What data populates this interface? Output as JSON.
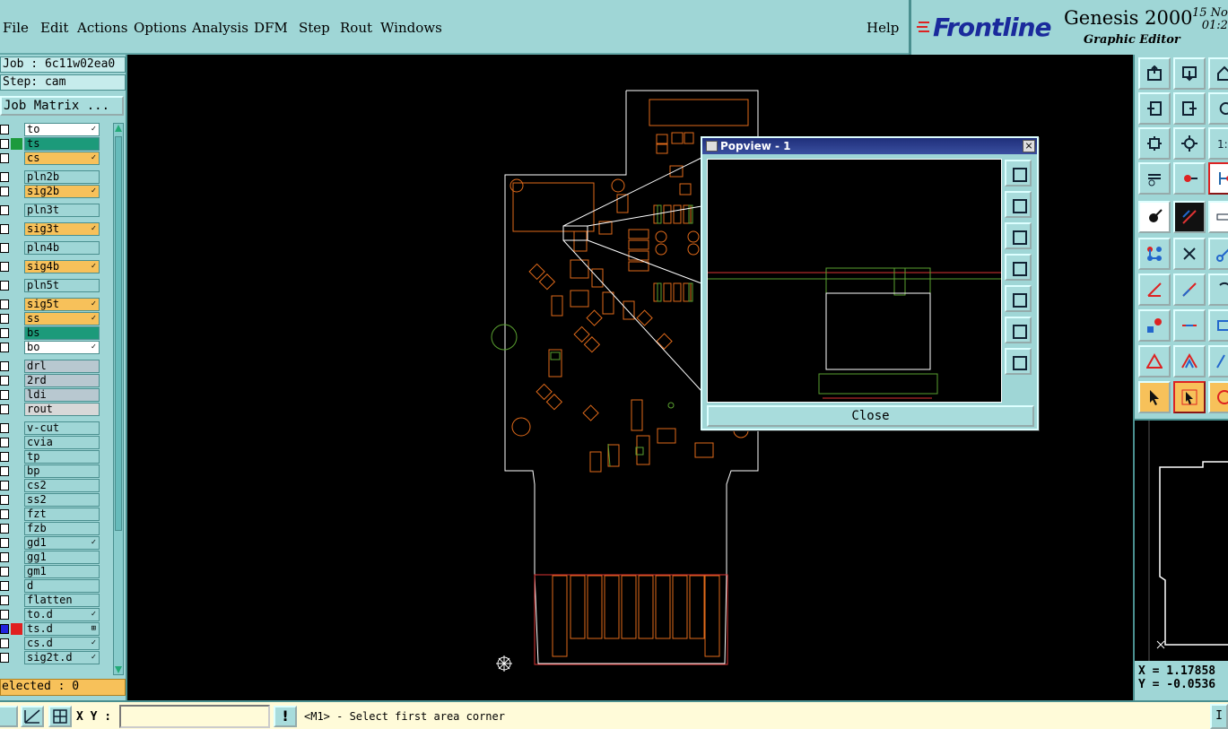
{
  "menu": {
    "items": [
      "File",
      "Edit",
      "Actions",
      "Options",
      "Analysis",
      "DFM",
      "Step",
      "Rout",
      "Windows"
    ],
    "help": "Help"
  },
  "brand": {
    "logo": "Frontline",
    "app": "Genesis 2000",
    "subtitle": "Graphic Editor",
    "date_line1": "15 No",
    "date_line2": "01:2"
  },
  "left": {
    "job": "Job : 6c11w02ea0",
    "step": "Step: cam",
    "job_matrix": "Job Matrix ...",
    "selected": "elected : 0",
    "layers": [
      {
        "name": "to",
        "bg": "#ffffff",
        "swatch": "",
        "mark": "✓"
      },
      {
        "name": "ts",
        "bg": "#1c9a7a",
        "swatch": "#1c9a3c",
        "mark": ""
      },
      {
        "name": "cs",
        "bg": "#f7c15a",
        "swatch": "",
        "mark": "✓"
      },
      {
        "name": "pln2b",
        "bg": "#9fd6d6",
        "swatch": "",
        "mark": ""
      },
      {
        "name": "sig2b",
        "bg": "#f7c15a",
        "swatch": "",
        "mark": "✓"
      },
      {
        "name": "pln3t",
        "bg": "#9fd6d6",
        "swatch": "",
        "mark": ""
      },
      {
        "name": "sig3t",
        "bg": "#f7c15a",
        "swatch": "",
        "mark": "✓"
      },
      {
        "name": "pln4b",
        "bg": "#9fd6d6",
        "swatch": "",
        "mark": ""
      },
      {
        "name": "sig4b",
        "bg": "#f7c15a",
        "swatch": "",
        "mark": "✓"
      },
      {
        "name": "pln5t",
        "bg": "#9fd6d6",
        "swatch": "",
        "mark": ""
      },
      {
        "name": "sig5t",
        "bg": "#f7c15a",
        "swatch": "",
        "mark": "✓"
      },
      {
        "name": "ss",
        "bg": "#f7c15a",
        "swatch": "",
        "mark": "✓"
      },
      {
        "name": "bs",
        "bg": "#1c9a7a",
        "swatch": "",
        "mark": ""
      },
      {
        "name": "bo",
        "bg": "#ffffff",
        "swatch": "",
        "mark": "✓"
      },
      {
        "name": "drl",
        "bg": "#b8c8d0",
        "swatch": "",
        "mark": ""
      },
      {
        "name": "2rd",
        "bg": "#b8c8d0",
        "swatch": "",
        "mark": ""
      },
      {
        "name": "ldi",
        "bg": "#b8c8d0",
        "swatch": "",
        "mark": ""
      },
      {
        "name": "rout",
        "bg": "#d8d8d8",
        "swatch": "",
        "mark": ""
      },
      {
        "name": "v-cut",
        "bg": "#9fd6d6",
        "swatch": "",
        "mark": ""
      },
      {
        "name": "cvia",
        "bg": "#9fd6d6",
        "swatch": "",
        "mark": ""
      },
      {
        "name": "tp",
        "bg": "#9fd6d6",
        "swatch": "",
        "mark": ""
      },
      {
        "name": "bp",
        "bg": "#9fd6d6",
        "swatch": "",
        "mark": ""
      },
      {
        "name": "cs2",
        "bg": "#9fd6d6",
        "swatch": "",
        "mark": ""
      },
      {
        "name": "ss2",
        "bg": "#9fd6d6",
        "swatch": "",
        "mark": ""
      },
      {
        "name": "fzt",
        "bg": "#9fd6d6",
        "swatch": "",
        "mark": ""
      },
      {
        "name": "fzb",
        "bg": "#9fd6d6",
        "swatch": "",
        "mark": ""
      },
      {
        "name": "gd1",
        "bg": "#9fd6d6",
        "swatch": "",
        "mark": "✓"
      },
      {
        "name": "gg1",
        "bg": "#9fd6d6",
        "swatch": "",
        "mark": ""
      },
      {
        "name": "gm1",
        "bg": "#9fd6d6",
        "swatch": "",
        "mark": ""
      },
      {
        "name": "d",
        "bg": "#9fd6d6",
        "swatch": "",
        "mark": ""
      },
      {
        "name": "flatten",
        "bg": "#9fd6d6",
        "swatch": "",
        "mark": ""
      },
      {
        "name": "to.d",
        "bg": "#9fd6d6",
        "swatch": "",
        "mark": "✓"
      },
      {
        "name": "ts.d",
        "bg": "#9fd6d6",
        "swatch": "#e02020",
        "mark": "⊞"
      },
      {
        "name": "cs.d",
        "bg": "#9fd6d6",
        "swatch": "",
        "mark": "✓"
      },
      {
        "name": "sig2t.d",
        "bg": "#9fd6d6",
        "swatch": "",
        "mark": "✓"
      }
    ]
  },
  "popview": {
    "title": "Popview - 1",
    "close": "Close"
  },
  "coords": {
    "x": "X = 1.17858",
    "y": "Y = -0.0536"
  },
  "bottom": {
    "xy_label": "X Y :",
    "xy_value": "",
    "bang": "!",
    "prompt": "<M1> - Select first area corner",
    "right": "I"
  },
  "colors": {
    "panel": "#9fd6d6",
    "orange_layer": "#f7c15a",
    "board_outline": "#ffffff",
    "copper_orange": "#e06a1a",
    "green_layer": "#5aa030"
  }
}
